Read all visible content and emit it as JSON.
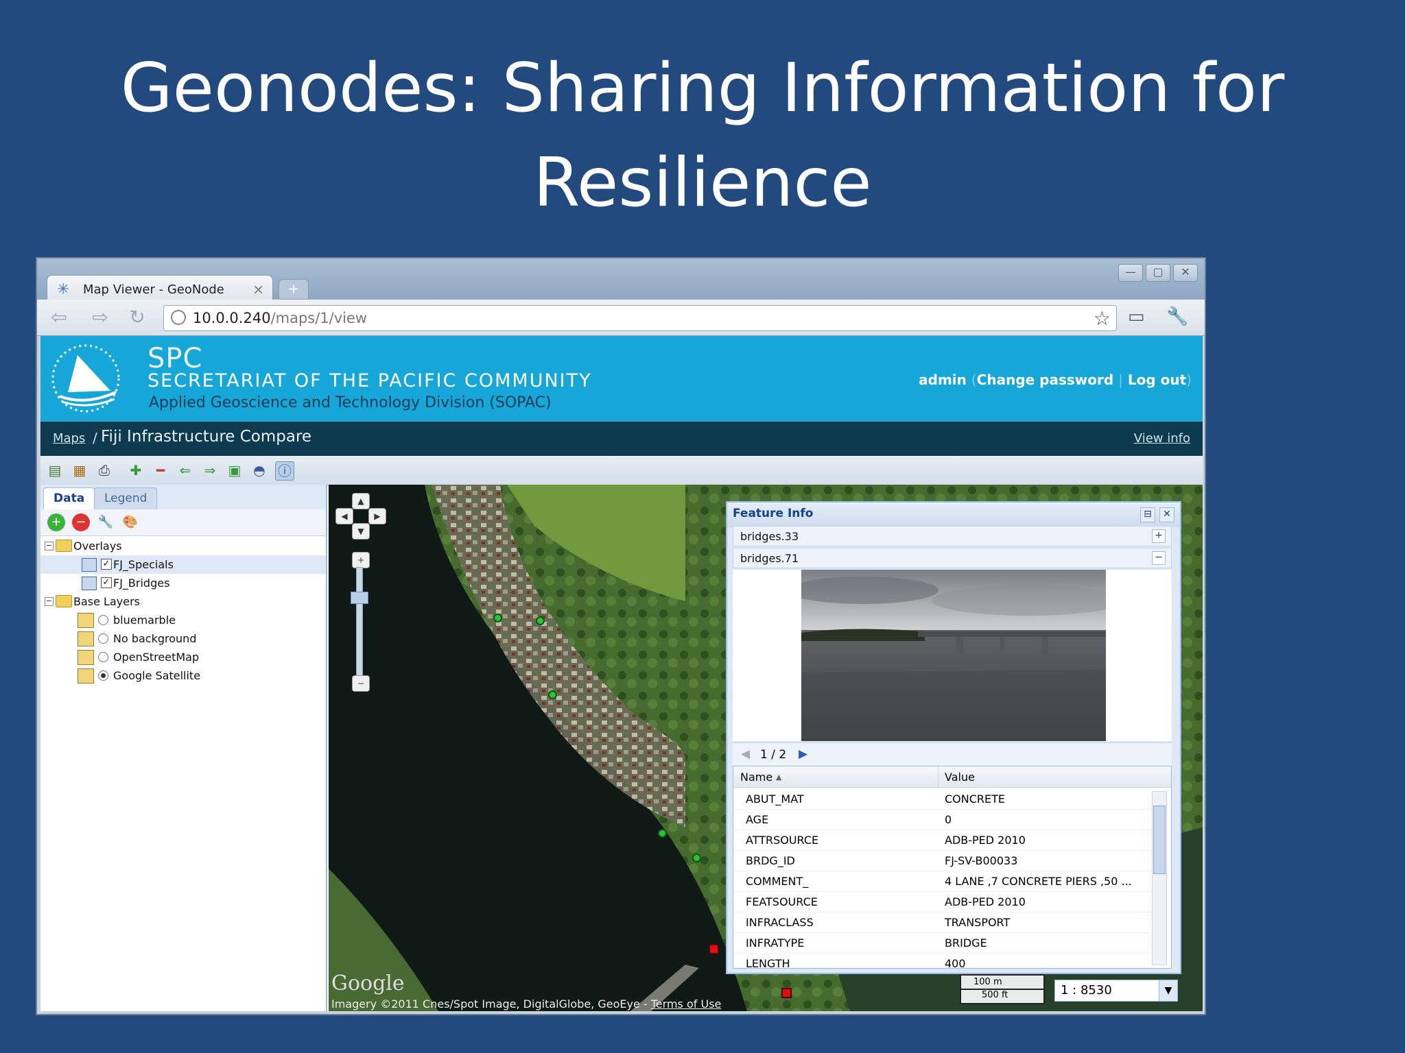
{
  "slide": {
    "title_line1": "Geonodes: Sharing Information for",
    "title_line2": "Resilience"
  },
  "browser": {
    "tab_label": "Map Viewer - GeoNode",
    "tab_close": "×",
    "new_tab": "+",
    "url_host": "10.0.0.240",
    "url_path": "/maps/1/view",
    "window_minimize": "—",
    "window_maximize": "▢",
    "window_close": "✕"
  },
  "site": {
    "spc": "SPC",
    "org_name": "SECRETARIAT OF THE PACIFIC COMMUNITY",
    "division": "Applied Geoscience and Technology Division (SOPAC)",
    "user": "admin",
    "change_password": "Change password",
    "log_out": "Log out",
    "breadcrumb_link": "Maps",
    "breadcrumb_sep": "/",
    "map_title": "Fiji Infrastructure Compare",
    "view_info": "View info"
  },
  "left_panel": {
    "tabs": [
      "Data",
      "Legend"
    ],
    "overlays_label": "Overlays",
    "overlays": [
      "FJ_Specials",
      "FJ_Bridges"
    ],
    "base_label": "Base Layers",
    "base_layers": [
      "bluemarble",
      "No background",
      "OpenStreetMap",
      "Google Satellite"
    ],
    "selected_base": "Google Satellite"
  },
  "map": {
    "google_logo": "Google",
    "attribution_prefix": "Imagery ©2011 Cnes/Spot Image, DigitalGlobe, GeoEye - ",
    "terms": "Terms of Use",
    "scale_m": "100 m",
    "scale_ft": "500 ft",
    "scale_ratio": "1 : 8530"
  },
  "feature_info": {
    "title": "Feature Info",
    "features": [
      "bridges.33",
      "bridges.71"
    ],
    "pager": "1 / 2",
    "col_name": "Name",
    "col_value": "Value",
    "rows": [
      {
        "name": "ABUT_MAT",
        "value": "CONCRETE"
      },
      {
        "name": "AGE",
        "value": "0"
      },
      {
        "name": "ATTRSOURCE",
        "value": "ADB-PED 2010"
      },
      {
        "name": "BRDG_ID",
        "value": "FJ-SV-B00033"
      },
      {
        "name": "COMMENT_",
        "value": "4 LANE ,7 CONCRETE PIERS ,50 ..."
      },
      {
        "name": "FEATSOURCE",
        "value": "ADB-PED 2010"
      },
      {
        "name": "INFRACLASS",
        "value": "TRANSPORT"
      },
      {
        "name": "INFRATYPE",
        "value": "BRIDGE"
      },
      {
        "name": "LENGTH",
        "value": "400"
      }
    ]
  },
  "colors": {
    "slide_bg": "#234a7e",
    "banner": "#16a6d8",
    "crumbbar": "#0d3a4e",
    "ext_blue": "#15428b"
  }
}
